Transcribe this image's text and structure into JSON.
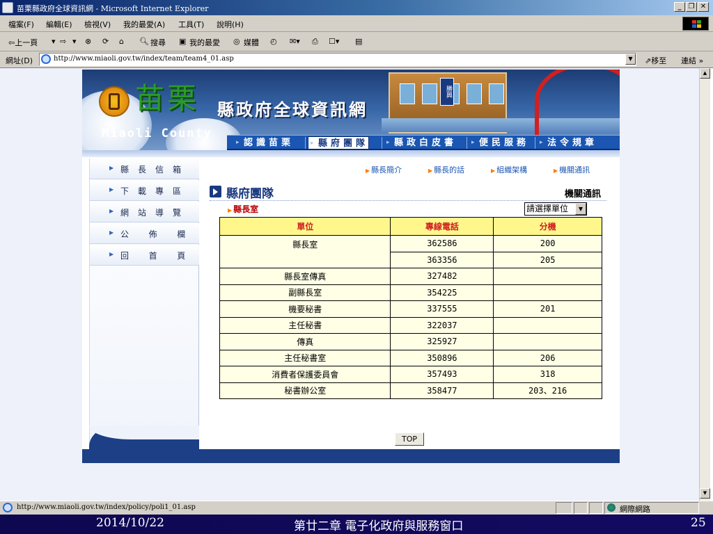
{
  "window": {
    "title": "苗栗縣政府全球資訊網 - Microsoft Internet Explorer"
  },
  "menu": {
    "items": [
      "檔案(F)",
      "編輯(E)",
      "檢視(V)",
      "我的最愛(A)",
      "工具(T)",
      "說明(H)"
    ]
  },
  "toolbar": {
    "back_label": "⇦上一頁",
    "search_label": "搜尋",
    "favorites_label": "我的最愛",
    "media_label": "媒體"
  },
  "address": {
    "label": "網址(D)",
    "url": "http://www.miaoli.gov.tw/index/team/team4_01.asp",
    "go_label": "移至",
    "links_label": "連結 »"
  },
  "banner": {
    "logo_title": "苗栗",
    "logo_subtitle": "縣政府全球資訊網",
    "logo_english": "Miaoli County",
    "sign_text": "勝興"
  },
  "topnav": {
    "items": [
      "認識苗栗",
      "縣府團隊",
      "縣政白皮書",
      "便民服務",
      "法令規章"
    ],
    "active_index": 1
  },
  "sidebar": {
    "items": [
      "縣長信箱",
      "下載專區",
      "網站導覽",
      "公  佈  欄",
      "回  首  頁"
    ]
  },
  "quicklinks": [
    "縣長簡介",
    "縣長的話",
    "組織架構",
    "機關通訊"
  ],
  "main": {
    "page_title": "縣府團隊",
    "section_title": "機關通訊",
    "breadcrumb": "縣長室",
    "unit_select": "請選擇單位",
    "top_button": "TOP"
  },
  "table": {
    "headers": [
      "單位",
      "專線電話",
      "分機"
    ],
    "rows": [
      {
        "unit": "縣長室",
        "phone": "362586",
        "ext": "200"
      },
      {
        "unit": "",
        "phone": "363356",
        "ext": "205"
      },
      {
        "unit": "縣長室傳真",
        "phone": "327482",
        "ext": ""
      },
      {
        "unit": "副縣長室",
        "phone": "354225",
        "ext": ""
      },
      {
        "unit": "機要秘書",
        "phone": "337555",
        "ext": "201"
      },
      {
        "unit": "主任秘書",
        "phone": "322037",
        "ext": ""
      },
      {
        "unit": "傳真",
        "phone": "325927",
        "ext": ""
      },
      {
        "unit": "主任秘書室",
        "phone": "350896",
        "ext": "206"
      },
      {
        "unit": "消費者保護委員會",
        "phone": "357493",
        "ext": "318"
      },
      {
        "unit": "秘書辦公室",
        "phone": "358477",
        "ext": "203、216"
      }
    ]
  },
  "status": {
    "url": "http://www.miaoli.gov.tw/index/policy/poli1_01.asp",
    "zone": "網際網路"
  },
  "slide_footer": {
    "date": "2014/10/22",
    "title": "第廿二章 電子化政府與服務窗口",
    "page": "25"
  },
  "colors": {
    "nav_blue": "#1a56b2",
    "header_yellow": "#fff78c",
    "header_text_red": "#d02020",
    "footer_navy": "#120a62"
  }
}
